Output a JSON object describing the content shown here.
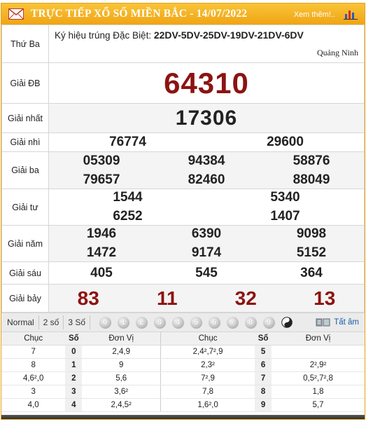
{
  "header": {
    "title": "TRỰC TIẾP XỔ SỐ MIỀN BẮC - 14/07/2022",
    "see_more": "Xem thêm!..",
    "icons": [
      "mail-icon",
      "bar-chart-icon"
    ],
    "colors": {
      "header_bg": "#f0a415",
      "prize_red": "#8b1411",
      "link": "#1a5ca8"
    }
  },
  "draw": {
    "weekday": "Thứ Ba",
    "special_code_label": "Ký hiệu trúng Đặc Biệt:",
    "special_codes": "22DV-5DV-25DV-19DV-21DV-6DV",
    "province": "Quảng Ninh"
  },
  "prizes": {
    "db": {
      "label": "Giải ĐB",
      "numbers": [
        "64310"
      ]
    },
    "g1": {
      "label": "Giải nhất",
      "numbers": [
        "17306"
      ]
    },
    "g2": {
      "label": "Giải nhì",
      "numbers": [
        "76774",
        "29600"
      ]
    },
    "g3": {
      "label": "Giải ba",
      "numbers": [
        "05309",
        "94384",
        "58876",
        "79657",
        "82460",
        "88049"
      ]
    },
    "g4": {
      "label": "Giải tư",
      "numbers": [
        "1544",
        "5340",
        "6252",
        "1407"
      ]
    },
    "g5": {
      "label": "Giải năm",
      "numbers": [
        "1946",
        "6390",
        "9098",
        "1472",
        "9174",
        "5152"
      ]
    },
    "g6": {
      "label": "Giải sáu",
      "numbers": [
        "405",
        "545",
        "364"
      ]
    },
    "g7": {
      "label": "Giải bảy",
      "numbers": [
        "83",
        "11",
        "32",
        "13"
      ]
    }
  },
  "toolbar": {
    "modes": [
      "Normal",
      "2 số",
      "3 Số"
    ],
    "digits": [
      "0",
      "1",
      "2",
      "3",
      "4",
      "5",
      "6",
      "7",
      "8",
      "9"
    ],
    "all_label": "Tất âm"
  },
  "loto": {
    "headers": {
      "chuc": "Chục",
      "so": "Số",
      "don_vi": "Đơn Vị"
    },
    "left": [
      {
        "chuc": "7",
        "so": "0",
        "don_vi": "2,4,9"
      },
      {
        "chuc": "8",
        "so": "1",
        "don_vi": "9"
      },
      {
        "chuc": "4,6²,0",
        "so": "2",
        "don_vi": "5,6"
      },
      {
        "chuc": "3",
        "so": "3",
        "don_vi": "3,6²"
      },
      {
        "chuc": "4,0",
        "so": "4",
        "don_vi": "2,4,5²"
      }
    ],
    "right": [
      {
        "chuc": "2,4²,7²,9",
        "so": "5",
        "don_vi": ""
      },
      {
        "chuc": "2,3²",
        "so": "6",
        "don_vi": "2²,9²"
      },
      {
        "chuc": "7²,9",
        "so": "7",
        "don_vi": "0,5²,7²,8"
      },
      {
        "chuc": "7,8",
        "so": "8",
        "don_vi": "1,8"
      },
      {
        "chuc": "1,6²,0",
        "so": "9",
        "don_vi": "5,7"
      }
    ]
  }
}
